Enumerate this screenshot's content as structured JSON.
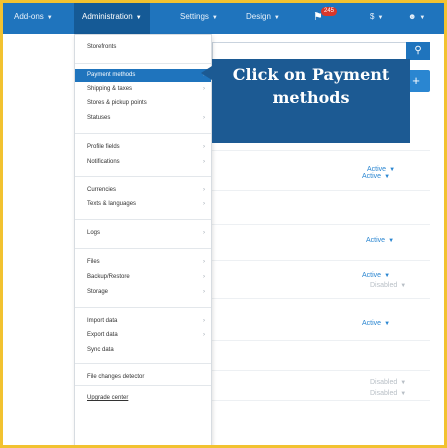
{
  "topnav": {
    "addons": "Add-ons",
    "administration": "Administration",
    "settings": "Settings",
    "design": "Design",
    "notifications_count": "245",
    "currency": "$"
  },
  "dropdown": {
    "groups": [
      [
        "Storefronts"
      ],
      [
        "Payment methods",
        "Shipping & taxes",
        "Stores & pickup points",
        "Statuses"
      ],
      [
        "Profile fields",
        "Notifications"
      ],
      [
        "Currencies",
        "Texts & languages"
      ],
      [
        "Logs"
      ],
      [
        "Files",
        "Backup/Restore",
        "Storage"
      ],
      [
        "Import data",
        "Export data",
        "Sync data"
      ],
      [
        "File changes detector"
      ],
      [
        "Upgrade center"
      ]
    ]
  },
  "tooltip": {
    "text_line1": "Click on Payment",
    "text_line2": "methods"
  },
  "statuses": [
    "Active",
    "Active",
    "Active",
    "Active",
    "Disabled",
    "Active",
    "Disabled",
    "Disabled"
  ],
  "colors": {
    "nav": "#1f74bd",
    "tooltip": "#1c5a93",
    "active": "#2a86d1",
    "frame": "#f2c230"
  }
}
